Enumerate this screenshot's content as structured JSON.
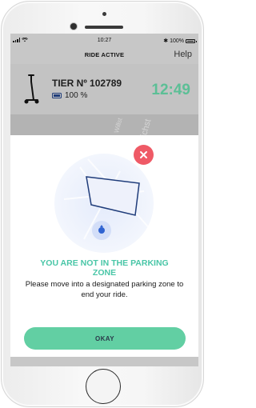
{
  "status_bar": {
    "time": "10:27",
    "battery_percent": "100%",
    "bluetooth_symbol": "✱"
  },
  "header": {
    "title": "RIDE ACTIVE",
    "help_label": "Help"
  },
  "ride": {
    "vehicle_name": "TIER Nº 102789",
    "battery_label": "100 %",
    "timer": "12:49"
  },
  "map": {
    "street_label_1": "Willst",
    "street_label_2": "richst"
  },
  "modal": {
    "headline_line1": "YOU ARE NOT IN THE PARKING",
    "headline_line2": "ZONE",
    "message": "Please move into a designated parking zone to end your ride.",
    "button_label": "OKAY"
  },
  "colors": {
    "accent": "#62cfa3",
    "headline": "#49c6a7",
    "timer": "#5cbf96",
    "close": "#ef5a66",
    "zone_fill": "#e8ecfb",
    "zone_stroke": "#1f3c7a"
  },
  "icons": {
    "close": "close-icon",
    "scooter": "scooter-icon",
    "location": "location-dot-icon",
    "battery": "battery-icon"
  }
}
